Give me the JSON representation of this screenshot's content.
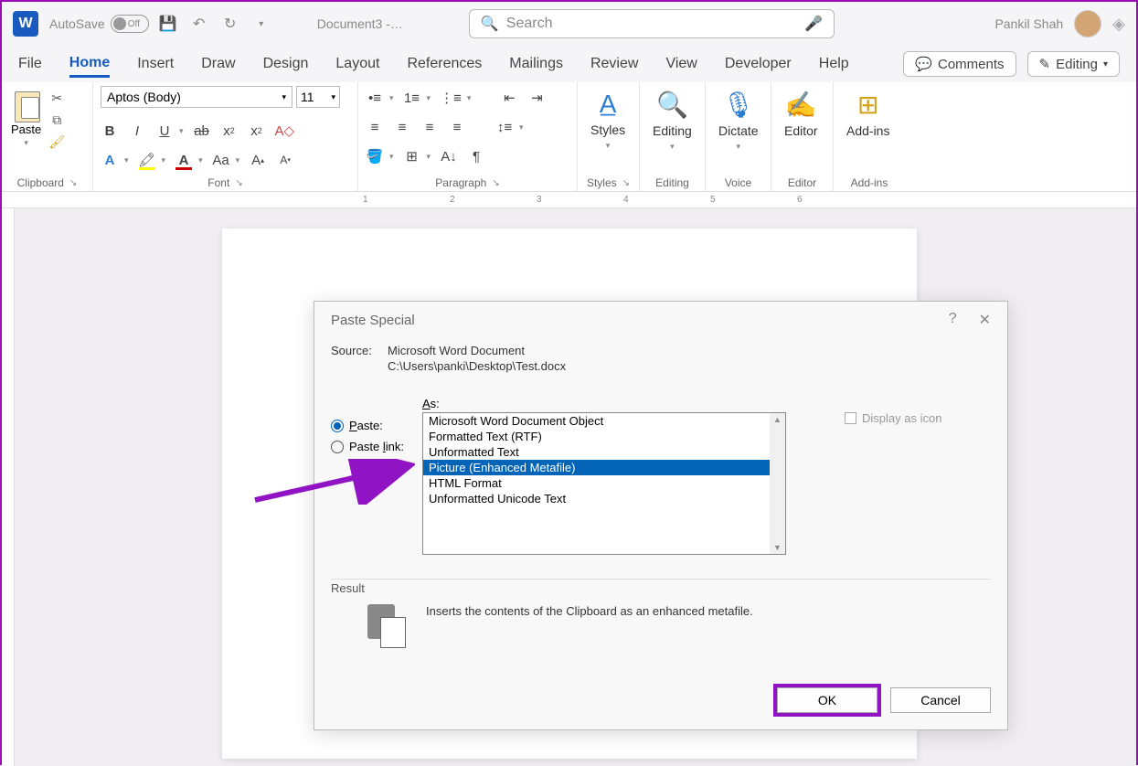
{
  "titlebar": {
    "autosave_label": "AutoSave",
    "autosave_state": "Off",
    "doc_title": "Document3 -…",
    "search_placeholder": "Search",
    "user_name": "Pankil Shah"
  },
  "tabs": {
    "items": [
      "File",
      "Home",
      "Insert",
      "Draw",
      "Design",
      "Layout",
      "References",
      "Mailings",
      "Review",
      "View",
      "Developer",
      "Help"
    ],
    "active": "Home",
    "comments": "Comments",
    "editing": "Editing"
  },
  "ribbon": {
    "clipboard": {
      "paste": "Paste",
      "label": "Clipboard"
    },
    "font": {
      "name": "Aptos (Body)",
      "size": "11",
      "label": "Font"
    },
    "paragraph": {
      "label": "Paragraph"
    },
    "styles": {
      "btn": "Styles",
      "label": "Styles"
    },
    "editing": {
      "btn": "Editing",
      "label": "Editing"
    },
    "voice": {
      "btn": "Dictate",
      "label": "Voice"
    },
    "editor": {
      "btn": "Editor",
      "label": "Editor"
    },
    "addins": {
      "btn": "Add-ins",
      "label": "Add-ins"
    }
  },
  "ruler": {
    "marks": [
      "1",
      "2",
      "3",
      "4",
      "5",
      "6"
    ]
  },
  "dialog": {
    "title": "Paste Special",
    "source_label": "Source:",
    "source_app": "Microsoft Word Document",
    "source_path": "C:\\Users\\panki\\Desktop\\Test.docx",
    "paste_label": "Paste:",
    "paste_link_label": "Paste link:",
    "as_label": "As:",
    "options": [
      "Microsoft Word Document Object",
      "Formatted Text (RTF)",
      "Unformatted Text",
      "Picture (Enhanced Metafile)",
      "HTML Format",
      "Unformatted Unicode Text"
    ],
    "selected_index": 3,
    "display_as_icon": "Display as icon",
    "result_label": "Result",
    "result_text": "Inserts the contents of the Clipboard as an enhanced metafile.",
    "ok": "OK",
    "cancel": "Cancel"
  }
}
